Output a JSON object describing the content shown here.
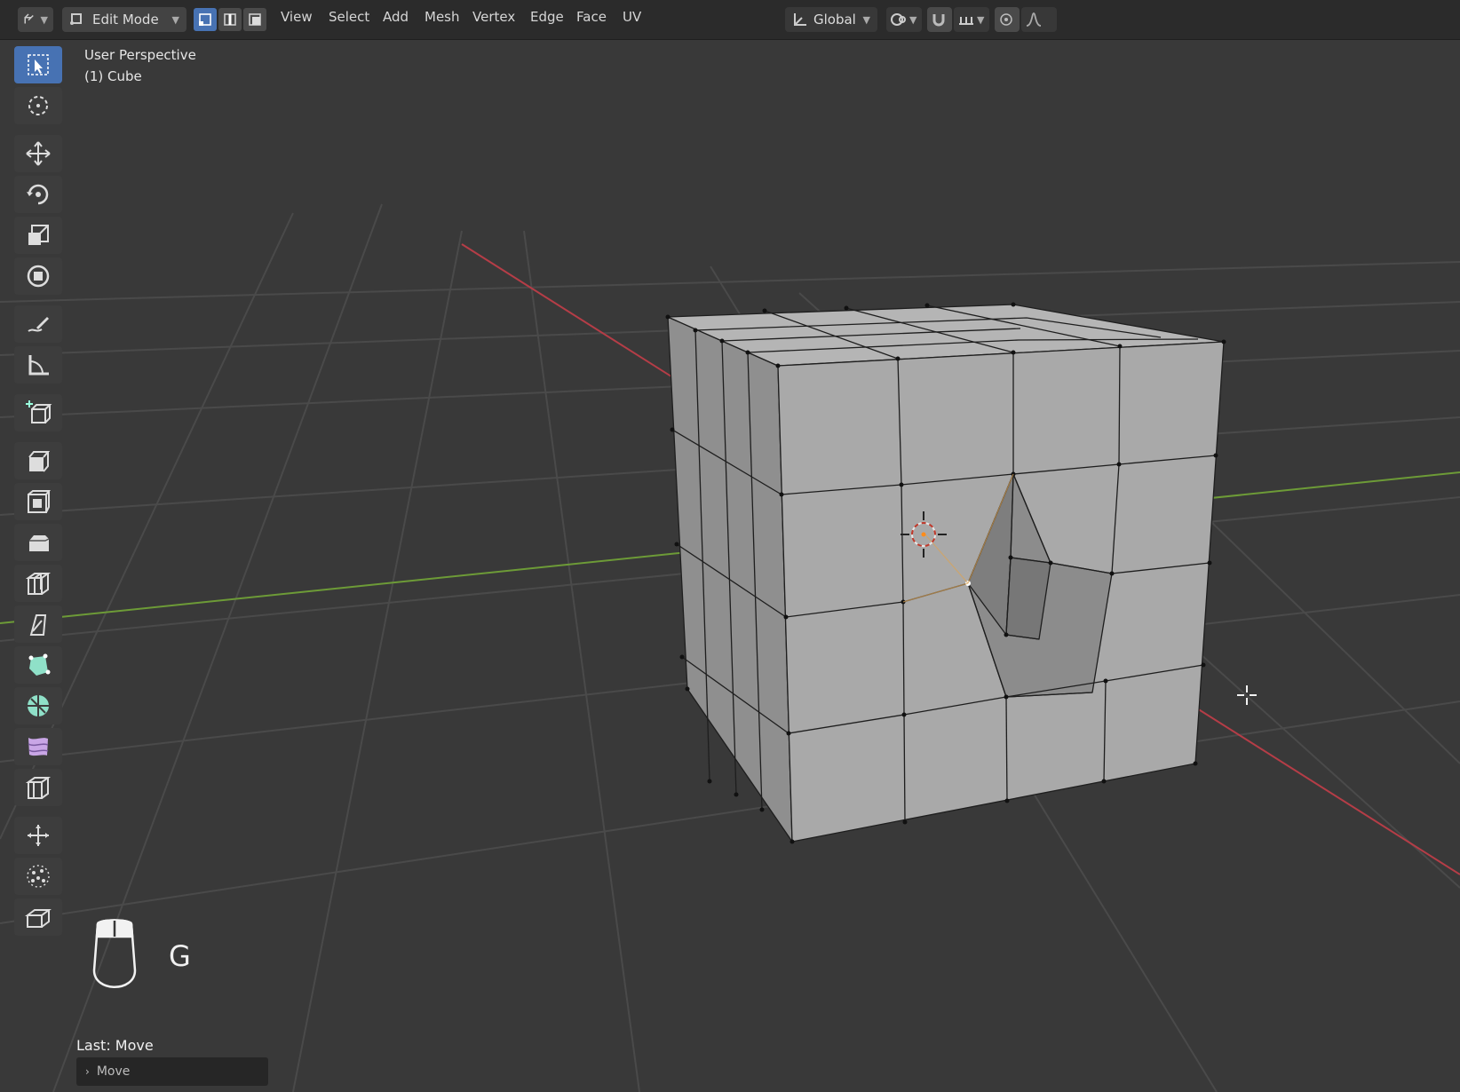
{
  "header": {
    "mode_label": "Edit Mode",
    "menus": [
      "View",
      "Select",
      "Add",
      "Mesh",
      "Vertex",
      "Edge",
      "Face",
      "UV"
    ],
    "orientation_label": "Global"
  },
  "viewport": {
    "view_name": "User Perspective",
    "object_name": "(1) Cube",
    "key_hint": "G"
  },
  "operator_panel": {
    "title": "Last: Move",
    "collapsed_label": "Move"
  },
  "toolbar": {
    "tools": [
      {
        "name": "select-box-tool",
        "icon": "select-box-icon",
        "active": true
      },
      {
        "name": "cursor-tool",
        "icon": "cursor-icon"
      },
      {
        "name": "move-tool",
        "icon": "move-icon"
      },
      {
        "name": "rotate-tool",
        "icon": "rotate-icon"
      },
      {
        "name": "scale-tool",
        "icon": "scale-icon"
      },
      {
        "name": "transform-tool",
        "icon": "transform-icon"
      },
      {
        "name": "annotate-tool",
        "icon": "annotate-icon"
      },
      {
        "name": "measure-tool",
        "icon": "measure-icon"
      },
      {
        "name": "add-cube-tool",
        "icon": "add-cube-icon"
      },
      {
        "name": "extrude-tool",
        "icon": "extrude-icon"
      },
      {
        "name": "inset-tool",
        "icon": "inset-icon"
      },
      {
        "name": "bevel-tool",
        "icon": "bevel-icon"
      },
      {
        "name": "loop-cut-tool",
        "icon": "loop-cut-icon"
      },
      {
        "name": "knife-tool",
        "icon": "knife-icon"
      },
      {
        "name": "poly-build-tool",
        "icon": "poly-build-icon"
      },
      {
        "name": "spin-tool",
        "icon": "spin-icon"
      },
      {
        "name": "smooth-tool",
        "icon": "smooth-icon"
      },
      {
        "name": "edge-slide-tool",
        "icon": "edge-slide-icon"
      },
      {
        "name": "shrink-fatten-tool",
        "icon": "shrink-fatten-icon"
      },
      {
        "name": "randomize-tool",
        "icon": "randomize-icon"
      },
      {
        "name": "rip-tool",
        "icon": "rip-icon"
      }
    ]
  },
  "colors": {
    "accent": "#4772b3",
    "x_axis": "#b53d47",
    "y_axis": "#6d9b37",
    "mesh_face": "#a9a9a9"
  }
}
